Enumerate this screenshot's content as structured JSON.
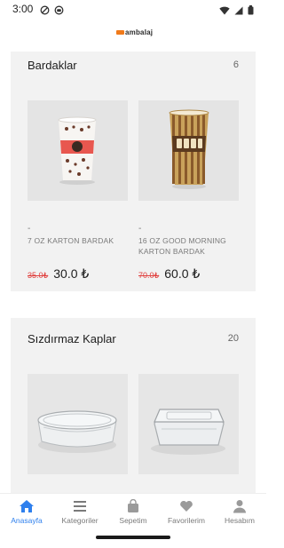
{
  "status_bar": {
    "time": "3:00",
    "left_icons": [
      "do-not-disturb-icon",
      "app-notification-icon"
    ],
    "right_icons": [
      "wifi-icon",
      "signal-icon",
      "battery-icon"
    ]
  },
  "header": {
    "logo_text": "ambalaj",
    "logo_accent_color": "#f07a1a"
  },
  "sections": [
    {
      "title": "Bardaklar",
      "count": "6",
      "products": [
        {
          "dash": "-",
          "name": "7 OZ KARTON BARDAK",
          "old_price": "35.0₺",
          "new_price": "30.0 ₺"
        },
        {
          "dash": "-",
          "name": "16 OZ GOOD MORNING KARTON BARDAK",
          "old_price": "70.0₺",
          "new_price": "60.0 ₺"
        }
      ]
    },
    {
      "title": "Sızdırmaz Kaplar",
      "count": "20",
      "products": [
        {
          "image_icon": "round-plastic-container-icon"
        },
        {
          "image_icon": "rectangular-plastic-container-icon"
        }
      ]
    }
  ],
  "bottom_nav": {
    "items": [
      {
        "label": "Anasayfa",
        "icon": "home-icon",
        "active": true
      },
      {
        "label": "Kategoriler",
        "icon": "menu-icon",
        "active": false
      },
      {
        "label": "Sepetim",
        "icon": "bag-icon",
        "active": false
      },
      {
        "label": "Favorilerim",
        "icon": "heart-icon",
        "active": false
      },
      {
        "label": "Hesabım",
        "icon": "person-icon",
        "active": false
      }
    ],
    "active_color": "#2f80ed",
    "inactive_color": "#7a7a7a"
  }
}
